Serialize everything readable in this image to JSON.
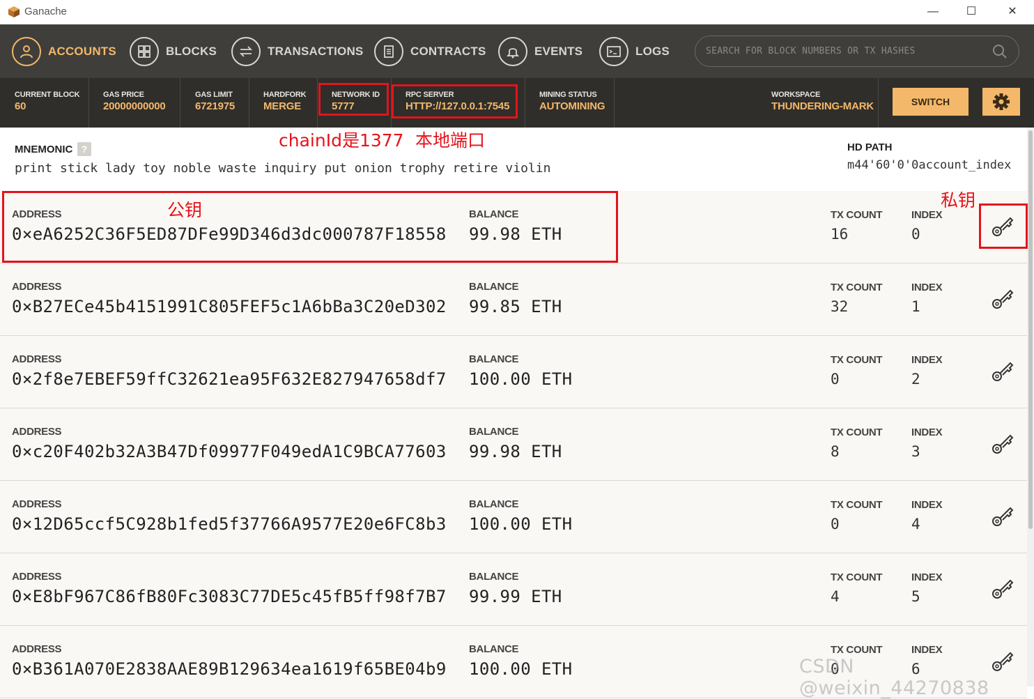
{
  "window": {
    "title": "Ganache",
    "minimize": "—",
    "maximize": "☐",
    "close": "✕"
  },
  "nav": {
    "items": [
      {
        "label": "ACCOUNTS",
        "icon": "user-icon",
        "active": true
      },
      {
        "label": "BLOCKS",
        "icon": "blocks-icon"
      },
      {
        "label": "TRANSACTIONS",
        "icon": "transfer-icon"
      },
      {
        "label": "CONTRACTS",
        "icon": "document-icon"
      },
      {
        "label": "EVENTS",
        "icon": "bell-icon"
      },
      {
        "label": "LOGS",
        "icon": "terminal-icon"
      }
    ],
    "search_placeholder": "SEARCH FOR BLOCK NUMBERS OR TX HASHES"
  },
  "status": {
    "current_block": {
      "label": "CURRENT BLOCK",
      "value": "60"
    },
    "gas_price": {
      "label": "GAS PRICE",
      "value": "20000000000"
    },
    "gas_limit": {
      "label": "GAS LIMIT",
      "value": "6721975"
    },
    "hardfork": {
      "label": "HARDFORK",
      "value": "MERGE"
    },
    "network_id": {
      "label": "NETWORK ID",
      "value": "5777"
    },
    "rpc_server": {
      "label": "RPC SERVER",
      "value": "HTTP://127.0.0.1:7545"
    },
    "mining_status": {
      "label": "MINING STATUS",
      "value": "AUTOMINING"
    },
    "workspace": {
      "label": "WORKSPACE",
      "value": "THUNDERING-MARK"
    },
    "switch_label": "SWITCH"
  },
  "annotations": {
    "chain_id": "chainId是1377",
    "local_port": "本地端口",
    "public_key": "公钥",
    "private_key": "私钥",
    "color": "#e5131b"
  },
  "mnemonic": {
    "label": "MNEMONIC",
    "help": "?",
    "words": "print stick lady toy noble waste inquiry put onion trophy retire violin",
    "hd_path_label": "HD PATH",
    "hd_path_value": "m44'60'0'0account_index"
  },
  "account_labels": {
    "address": "ADDRESS",
    "balance": "BALANCE",
    "tx_count": "TX COUNT",
    "index": "INDEX"
  },
  "accounts": [
    {
      "address": "0×eA6252C36F5ED87DFe99D346d3dc000787F18558",
      "balance": "99.98 ETH",
      "tx_count": "16",
      "index": "0"
    },
    {
      "address": "0×B27ECe45b4151991C805FEF5c1A6bBa3C20eD302",
      "balance": "99.85 ETH",
      "tx_count": "32",
      "index": "1"
    },
    {
      "address": "0×2f8e7EBEF59ffC32621ea95F632E827947658df7",
      "balance": "100.00 ETH",
      "tx_count": "0",
      "index": "2"
    },
    {
      "address": "0×c20F402b32A3B47Df09977F049edA1C9BCA77603",
      "balance": "99.98 ETH",
      "tx_count": "8",
      "index": "3"
    },
    {
      "address": "0×12D65ccf5C928b1fed5f37766A9577E20e6FC8b3",
      "balance": "100.00 ETH",
      "tx_count": "0",
      "index": "4"
    },
    {
      "address": "0×E8bF967C86fB80Fc3083C77DE5c45fB5ff98f7B7",
      "balance": "99.99 ETH",
      "tx_count": "4",
      "index": "5"
    },
    {
      "address": "0×B361A070E2838AAE89B129634ea1619f65BE04b9",
      "balance": "100.00 ETH",
      "tx_count": "0",
      "index": "6"
    }
  ],
  "watermark": "CSDN @weixin_44270838",
  "colors": {
    "accent": "#f4b86a",
    "nav_bg": "#3f3e3b",
    "status_bg": "#2f2e2b",
    "row_bg": "#faf8f5"
  }
}
